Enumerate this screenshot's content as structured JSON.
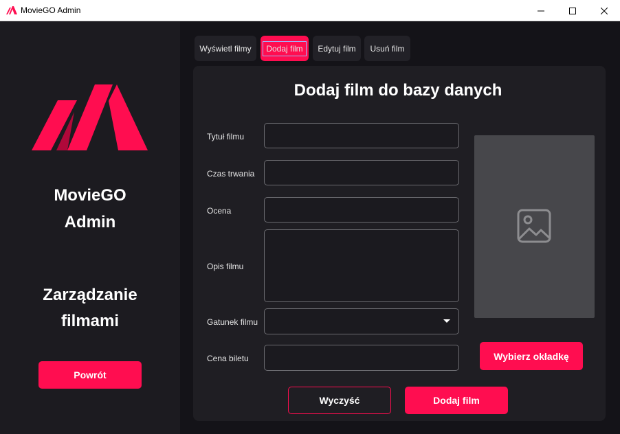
{
  "window": {
    "title": "MovieGO Admin",
    "icon": "moviego-logo-icon",
    "controls": [
      "minimize-icon",
      "maximize-icon",
      "close-icon"
    ]
  },
  "sidebar": {
    "app_name_line1": "MovieGO",
    "app_name_line2": "Admin",
    "section_line1": "Zarządzanie",
    "section_line2": "filmami",
    "back_button": "Powrót"
  },
  "tabs": [
    {
      "label": "Wyświetl filmy",
      "active": false
    },
    {
      "label": "Dodaj film",
      "active": true
    },
    {
      "label": "Edytuj film",
      "active": false
    },
    {
      "label": "Usuń film",
      "active": false
    }
  ],
  "form": {
    "title": "Dodaj film do bazy danych",
    "fields": {
      "title": {
        "label": "Tytuł filmu",
        "value": ""
      },
      "duration": {
        "label": "Czas trwania",
        "value": ""
      },
      "rating": {
        "label": "Ocena",
        "value": ""
      },
      "description": {
        "label": "Opis filmu",
        "value": ""
      },
      "genre": {
        "label": "Gatunek filmu",
        "value": ""
      },
      "price": {
        "label": "Cena biletu",
        "value": ""
      }
    },
    "cover_placeholder_icon": "image-placeholder-icon",
    "choose_cover_button": "Wybierz okładkę",
    "clear_button": "Wyczyść",
    "submit_button": "Dodaj film"
  },
  "colors": {
    "accent": "#ff0d50",
    "sidebar_bg": "#1c1b20",
    "main_bg": "#141318",
    "card_bg": "#1f1e23",
    "cover_bg": "#47474b"
  }
}
